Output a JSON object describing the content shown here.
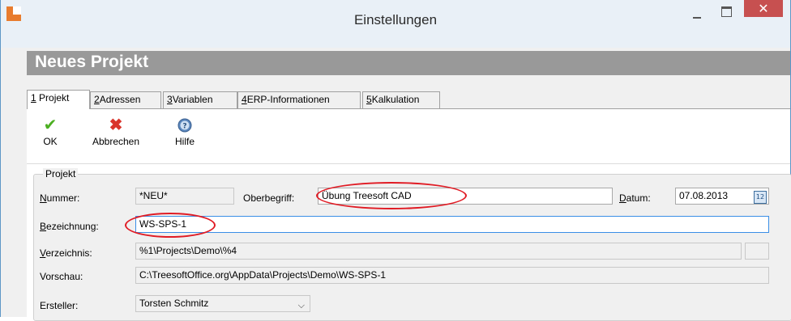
{
  "window": {
    "title": "Einstellungen",
    "close_glyph": "✕",
    "accent_color": "#c75050"
  },
  "header": {
    "title": "Neues Projekt"
  },
  "tabs": [
    {
      "num": "1",
      "label": "Projekt"
    },
    {
      "num": "2",
      "label": "Adressen"
    },
    {
      "num": "3",
      "label": "Variablen"
    },
    {
      "num": "4",
      "label": "ERP-Informationen"
    },
    {
      "num": "5",
      "label": "Kalkulation"
    }
  ],
  "toolbar": {
    "ok_label": "OK",
    "cancel_label": "Abbrechen",
    "help_label": "Hilfe",
    "ok_icon": "check-icon",
    "cancel_icon": "x-icon",
    "help_icon": "help-icon"
  },
  "form": {
    "group_title": "Projekt",
    "nummer_label_u": "N",
    "nummer_label_rest": "ummer:",
    "nummer_value": "*NEU*",
    "oberbegriff_label": "Oberbegriff:",
    "oberbegriff_value": "Übung Treesoft CAD",
    "datum_label_u": "D",
    "datum_label_rest": "atum:",
    "datum_value": "07.08.2013",
    "bezeichnung_label_u": "B",
    "bezeichnung_label_rest": "ezeichnung:",
    "bezeichnung_value": "WS-SPS-1",
    "verzeichnis_label_u": "V",
    "verzeichnis_label_rest": "erzeichnis:",
    "verzeichnis_value": "%1\\Projects\\Demo\\%4",
    "vorschau_label": "Vorschau:",
    "vorschau_value": "C:\\TreesoftOffice.org\\AppData\\Projects\\Demo\\WS-SPS-1",
    "ersteller_label": "Ersteller:",
    "ersteller_value": "Torsten Schmitz",
    "calendar_glyph": "12"
  },
  "annotations": {
    "highlight_color": "#e01b24"
  }
}
